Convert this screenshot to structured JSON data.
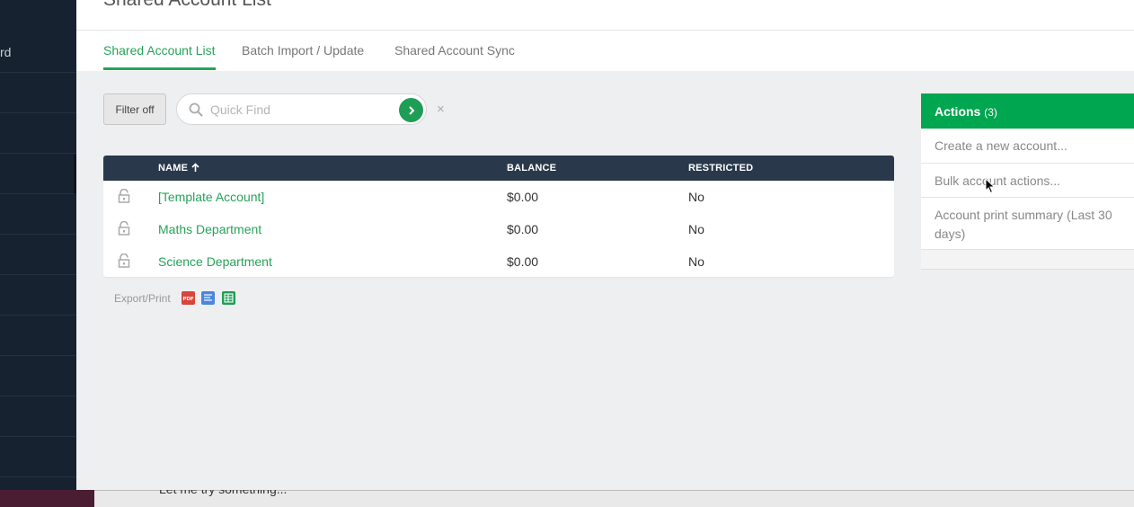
{
  "sidebar": {
    "partial_label": "rd"
  },
  "page": {
    "title": "Shared Account List"
  },
  "tabs": [
    {
      "label": "Shared Account List"
    },
    {
      "label": "Batch Import / Update"
    },
    {
      "label": "Shared Account Sync"
    }
  ],
  "filter": {
    "button_label": "Filter off"
  },
  "search": {
    "placeholder": "Quick Find",
    "value": "",
    "clear_label": "×"
  },
  "table": {
    "headers": {
      "name": "NAME",
      "balance": "BALANCE",
      "restricted": "RESTRICTED"
    },
    "rows": [
      {
        "name": "[Template Account]",
        "balance": "$0.00",
        "restricted": "No"
      },
      {
        "name": "Maths Department",
        "balance": "$0.00",
        "restricted": "No"
      },
      {
        "name": "Science Department",
        "balance": "$0.00",
        "restricted": "No"
      }
    ]
  },
  "export": {
    "label": "Export/Print",
    "icons": [
      "pdf-icon",
      "document-icon",
      "spreadsheet-icon"
    ]
  },
  "actions": {
    "title": "Actions",
    "count": "(3)",
    "items": [
      {
        "label": "Create a new account..."
      },
      {
        "label": "Bulk account actions..."
      },
      {
        "label": "Account print summary (Last 30 days)"
      }
    ]
  },
  "background_window": {
    "text": "Let me try something..."
  },
  "colors": {
    "accent": "#27a25a",
    "actions_header": "#00a650",
    "table_header": "#29384a",
    "sidebar": "#172230"
  }
}
